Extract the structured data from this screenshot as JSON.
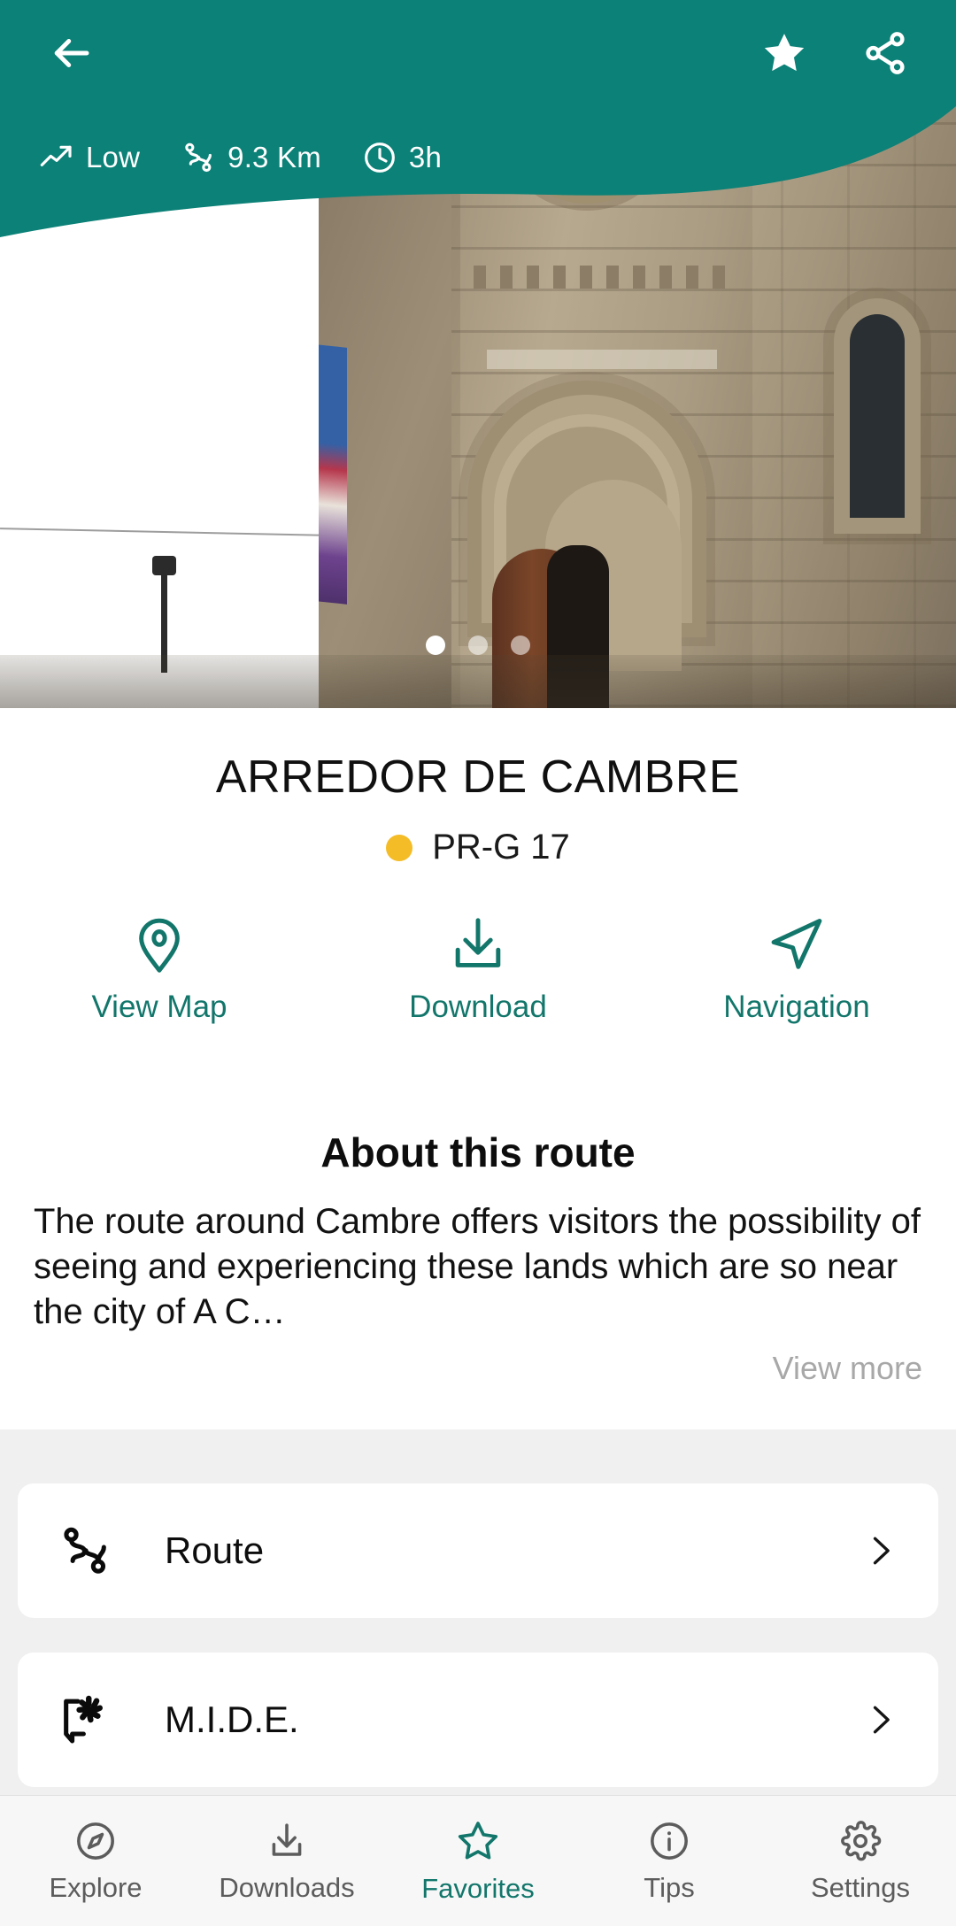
{
  "header": {
    "back_icon": "arrow-left-icon",
    "favorite_icon": "star-filled-icon",
    "share_icon": "share-icon",
    "accent_color": "#0b8177",
    "stats": [
      {
        "icon": "trending-up-icon",
        "value": "Low"
      },
      {
        "icon": "winding-route-icon",
        "value": "9.3 Km"
      },
      {
        "icon": "clock-icon",
        "value": "3h"
      }
    ]
  },
  "carousel": {
    "total": 3,
    "active_index": 0,
    "image_alt": "Romanesque church of Santa Maria de Cambre"
  },
  "route": {
    "title": "ARREDOR DE CAMBRE",
    "code": "PR-G 17",
    "code_color": "#f4bc26"
  },
  "actions": [
    {
      "icon": "map-pin-icon",
      "label": "View Map"
    },
    {
      "icon": "download-icon",
      "label": "Download"
    },
    {
      "icon": "navigation-arrow-icon",
      "label": "Navigation"
    }
  ],
  "about": {
    "heading": "About this route",
    "body": "The route around Cambre offers visitors the possibility of seeing and experiencing these lands which are so near the city of A C…",
    "view_more": "View more"
  },
  "cards": [
    {
      "icon": "winding-route-icon",
      "label": "Route",
      "chevron": "chevron-right-icon"
    },
    {
      "icon": "mide-speech-flower-icon",
      "label": "M.I.D.E.",
      "chevron": "chevron-right-icon"
    }
  ],
  "bottom_nav": {
    "active_index": 2,
    "active_color": "#12766b",
    "inactive_color": "#5c5c5c",
    "items": [
      {
        "icon": "compass-icon",
        "label": "Explore"
      },
      {
        "icon": "download-icon",
        "label": "Downloads"
      },
      {
        "icon": "star-outline-icon",
        "label": "Favorites"
      },
      {
        "icon": "info-circle-icon",
        "label": "Tips"
      },
      {
        "icon": "gear-icon",
        "label": "Settings"
      }
    ]
  }
}
